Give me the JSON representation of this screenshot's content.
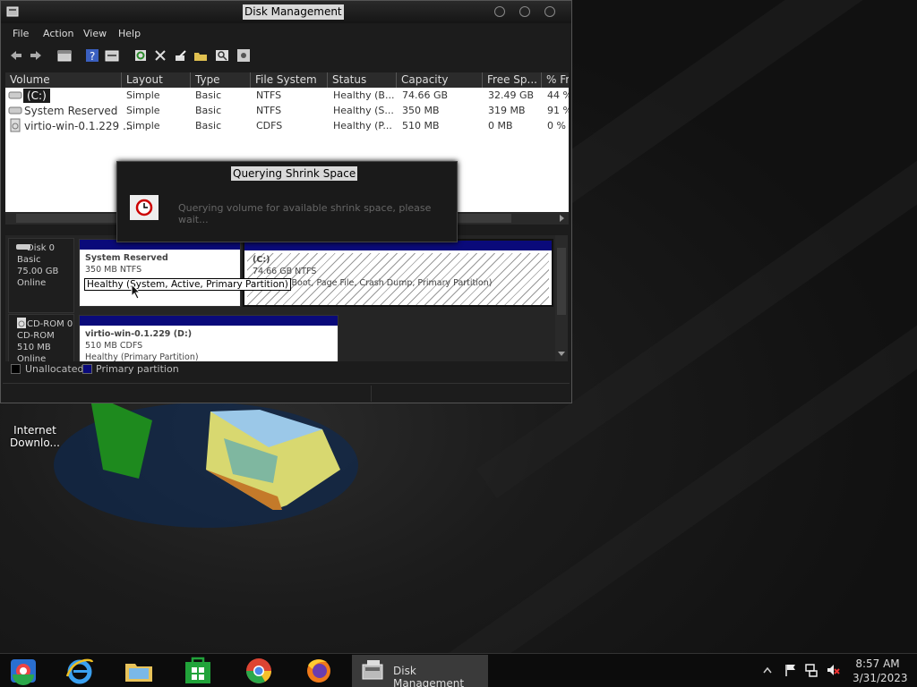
{
  "window": {
    "title": "Disk Management",
    "menu": [
      "File",
      "Action",
      "View",
      "Help"
    ]
  },
  "volumes": {
    "columns": [
      "Volume",
      "Layout",
      "Type",
      "File System",
      "Status",
      "Capacity",
      "Free Sp...",
      "% Fr"
    ],
    "rows": [
      {
        "volume": "(C:)",
        "layout": "Simple",
        "type": "Basic",
        "fs": "NTFS",
        "status": "Healthy (B...",
        "capacity": "74.66 GB",
        "free": "32.49 GB",
        "pct": "44 %"
      },
      {
        "volume": "System Reserved",
        "layout": "Simple",
        "type": "Basic",
        "fs": "NTFS",
        "status": "Healthy (S...",
        "capacity": "350 MB",
        "free": "319 MB",
        "pct": "91 %"
      },
      {
        "volume": "virtio-win-0.1.229 ...",
        "layout": "Simple",
        "type": "Basic",
        "fs": "CDFS",
        "status": "Healthy (P...",
        "capacity": "510 MB",
        "free": "0 MB",
        "pct": "0 %"
      }
    ]
  },
  "disks": [
    {
      "name": "Disk 0",
      "kind": "Basic",
      "size": "75.00 GB",
      "state": "Online",
      "partitions": [
        {
          "name": "System Reserved",
          "size": "350 MB NTFS",
          "status": "Healthy (System, Active, Primary Partition)"
        },
        {
          "name": "(C:)",
          "size": "74.66 GB NTFS",
          "status": "Healthy (Boot, Page File, Crash Dump, Primary Partition)"
        }
      ]
    },
    {
      "name": "CD-ROM 0",
      "kind": "CD-ROM",
      "size": "510 MB",
      "state": "Online",
      "partitions": [
        {
          "name": "virtio-win-0.1.229  (D:)",
          "size": "510 MB CDFS",
          "status": "Healthy (Primary Partition)"
        }
      ]
    }
  ],
  "legend": {
    "unallocated": "Unallocated",
    "primary": "Primary partition"
  },
  "tooltip": "Healthy (System, Active, Primary Partition)",
  "dialog": {
    "title": "Querying Shrink Space",
    "message": "Querying volume for available shrink space, please wait..."
  },
  "desktop": {
    "icon_label": "Internet Downlo..."
  },
  "taskbar": {
    "active_app": "Disk Management",
    "time": "8:57 AM",
    "date": "3/31/2023"
  },
  "colors": {
    "primary_partition": "#0a0a7a",
    "accent": "#d9d9d9"
  }
}
